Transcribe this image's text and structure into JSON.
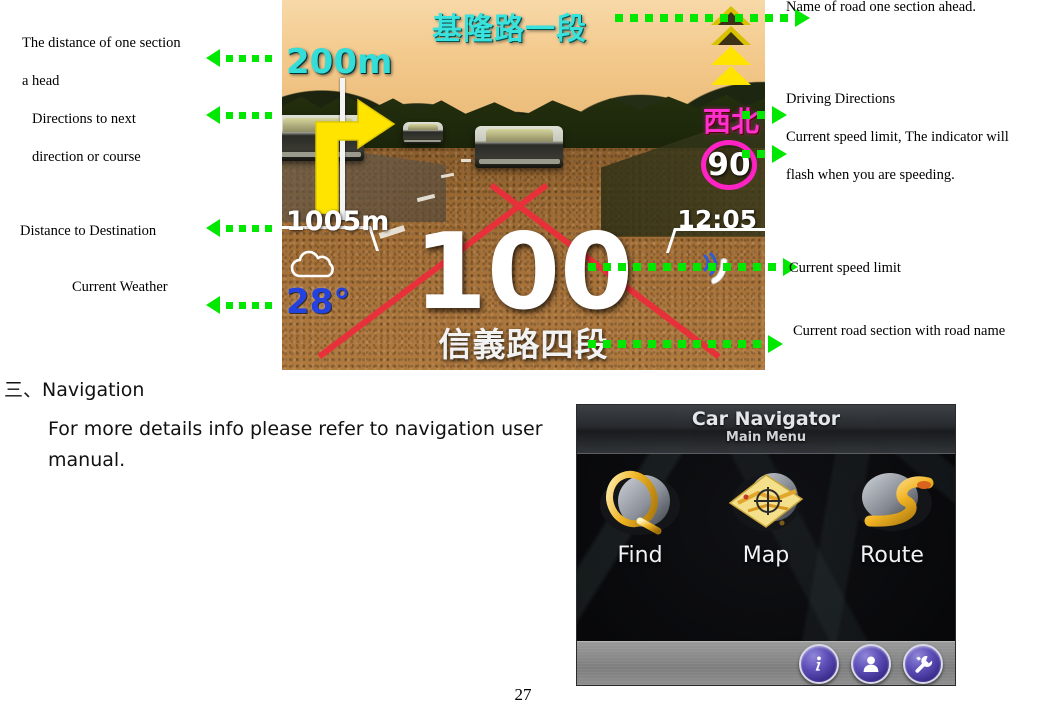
{
  "annotations": {
    "left": [
      {
        "id": "dist-one-section",
        "text": "The distance of one section"
      },
      {
        "id": "dist-one-section-2",
        "text": "a head"
      },
      {
        "id": "directions-next",
        "text": "Directions to next"
      },
      {
        "id": "directions-next-2",
        "text": "direction or course"
      },
      {
        "id": "dist-destination",
        "text": "Distance to Destination"
      },
      {
        "id": "current-weather",
        "text": "Current Weather"
      }
    ],
    "right": [
      {
        "id": "road-name-ahead",
        "text": "Name of road one section ahead."
      },
      {
        "id": "driving-directions",
        "text": "Driving Directions"
      },
      {
        "id": "speed-limit-flash",
        "text": "Current speed limit, The indicator will"
      },
      {
        "id": "speed-limit-flash-2",
        "text": "flash when you are speeding."
      },
      {
        "id": "current-speed-limit",
        "text": "Current speed limit"
      },
      {
        "id": "current-road-section",
        "text": "Current road section with road name"
      }
    ]
  },
  "nav_screen": {
    "next_road_name": "基隆路一段",
    "distance_next_turn": "200m",
    "distance_destination": "1005m",
    "temperature": "28°",
    "current_speed": "100",
    "current_road_name": "信義路四段",
    "compass_direction": "西北",
    "speed_limit": "90",
    "time": "12:05",
    "turn_icon": "turn-right-arrow",
    "weather_icon": "cloudy-icon",
    "phone_icon": "phone-icon",
    "colors": {
      "next_road": "#3ae2de",
      "distance": "#35ddd9",
      "temperature": "#2342e0",
      "direction": "#ff2fd0",
      "speed_limit_ring": "#ff22c4",
      "turn_arrow": "#ffe400",
      "route_line": "#e8303a",
      "lane_line": "#e8b52a"
    },
    "gradient_indicator": [
      "hollow",
      "hollow",
      "filled",
      "filled"
    ]
  },
  "section": {
    "heading": "三、Navigation",
    "body_line1": "For more details info please refer to navigation user",
    "body_line2": "manual."
  },
  "navigator": {
    "title": "Car Navigator",
    "subtitle": "Main Menu",
    "menu_items": [
      {
        "label": "Find",
        "icon": "magnifier-ring-icon"
      },
      {
        "label": "Map",
        "icon": "map-compass-icon"
      },
      {
        "label": "Route",
        "icon": "route-s-curve-icon"
      }
    ],
    "toolbar_buttons": [
      {
        "name": "info-button",
        "icon": "info-icon",
        "glyph": "i"
      },
      {
        "name": "user-button",
        "icon": "user-icon",
        "glyph": "person"
      },
      {
        "name": "settings-button",
        "icon": "wrench-icon",
        "glyph": "wrench"
      }
    ],
    "accent_color": "#5d4fb8"
  },
  "footer": {
    "page_number": "27"
  }
}
